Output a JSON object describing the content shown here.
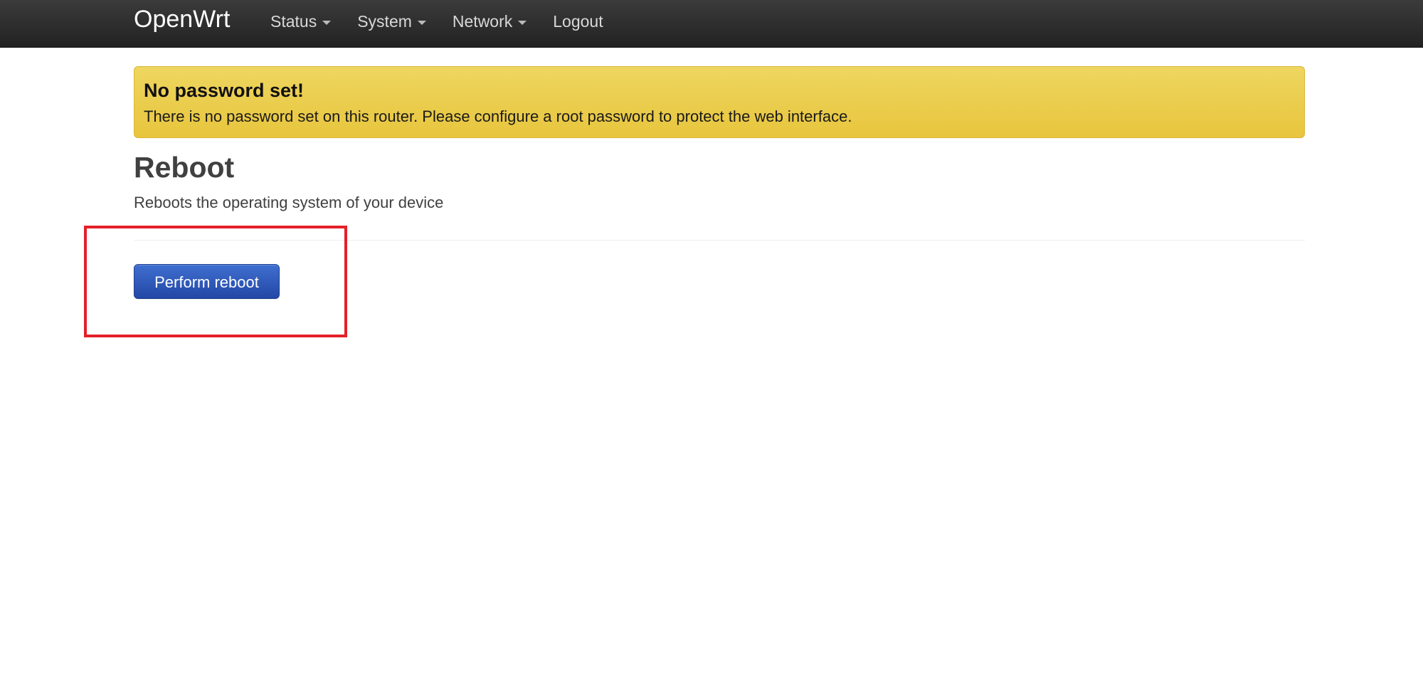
{
  "header": {
    "brand": "OpenWrt",
    "menu": [
      {
        "label": "Status",
        "dropdown": true
      },
      {
        "label": "System",
        "dropdown": true
      },
      {
        "label": "Network",
        "dropdown": true
      },
      {
        "label": "Logout",
        "dropdown": false
      }
    ]
  },
  "alert": {
    "title": "No password set!",
    "text": "There is no password set on this router. Please configure a root password to protect the web interface.",
    "color": "#e8c53d"
  },
  "main": {
    "title": "Reboot",
    "description": "Reboots the operating system of your device",
    "reboot_button": "Perform reboot"
  },
  "colors": {
    "navbar": "#222222",
    "button": "#2347a5",
    "highlight": "#e3202a"
  }
}
